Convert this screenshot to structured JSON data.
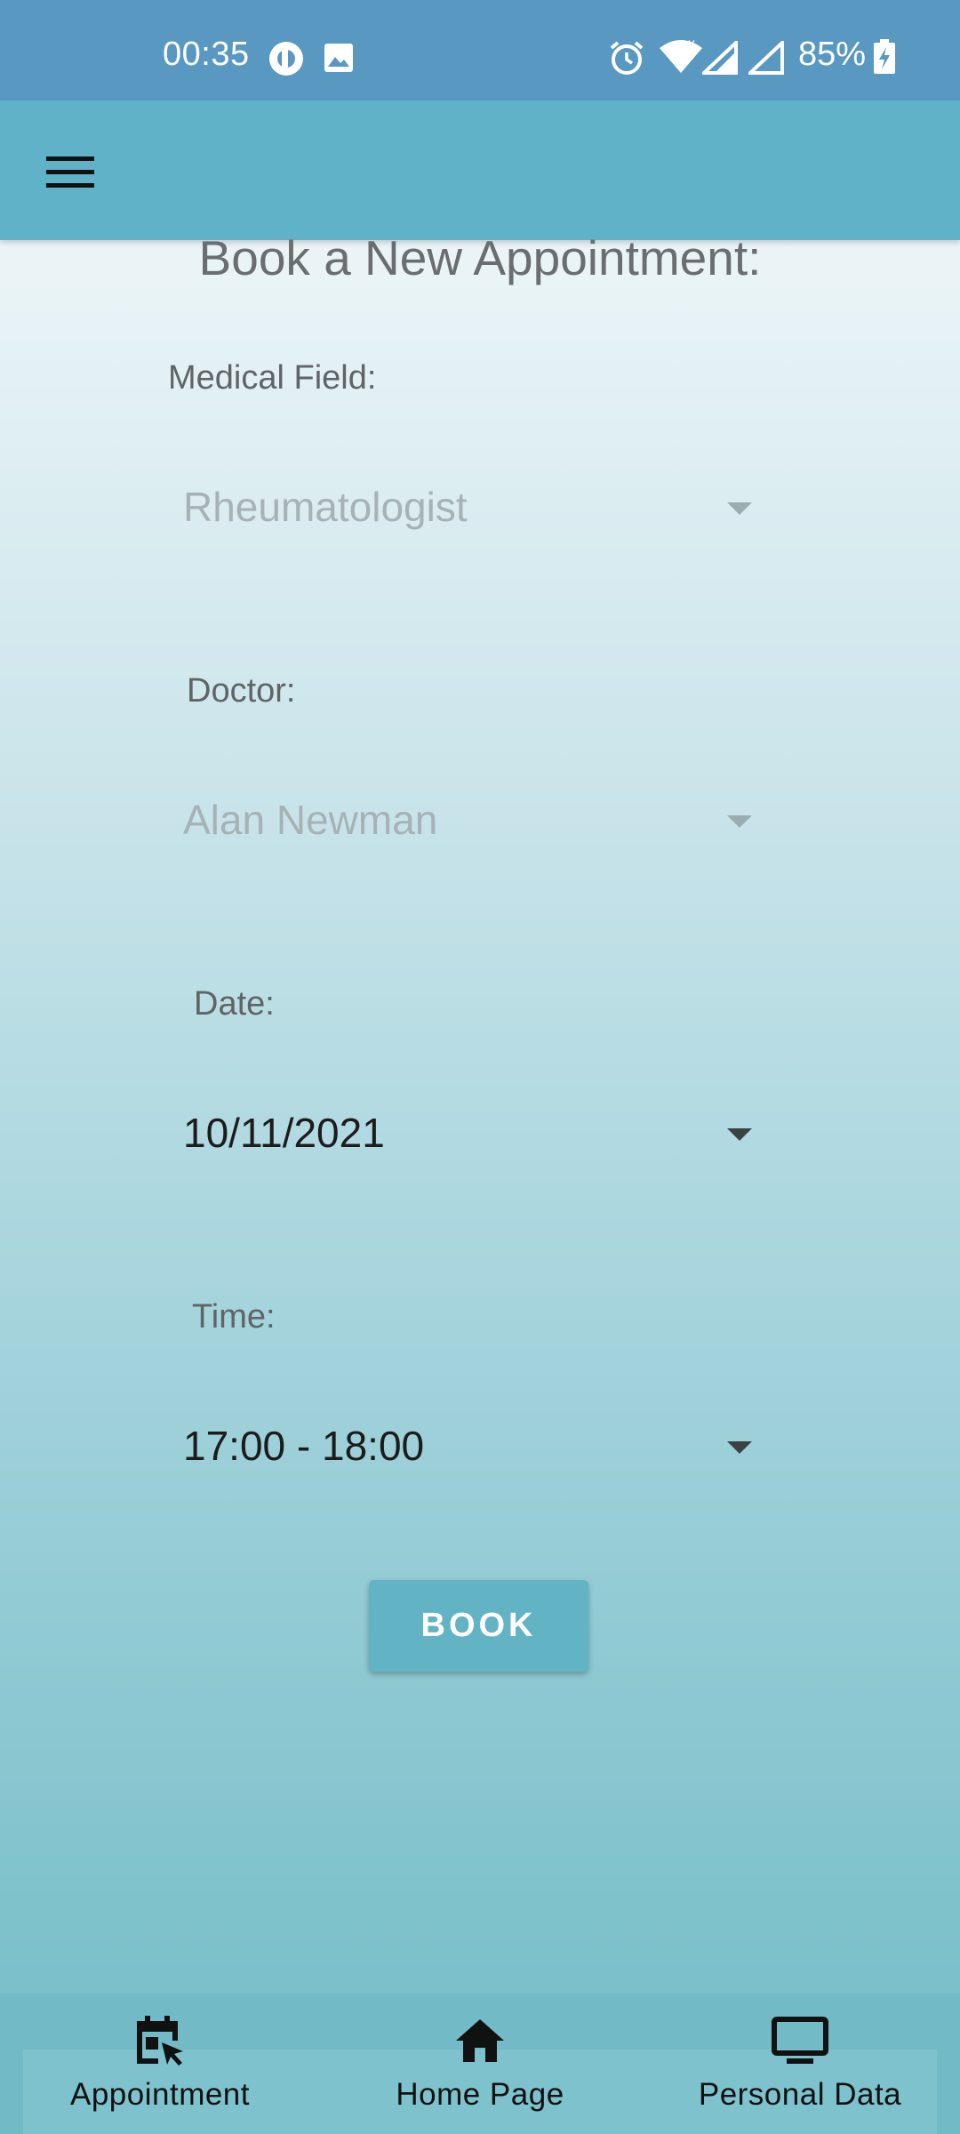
{
  "status_bar": {
    "time": "00:35",
    "battery": "85%",
    "icons": [
      "pocket-casts-icon",
      "image-icon",
      "alarm-icon",
      "wifi-icon",
      "signal-icon",
      "signal-icon",
      "battery-charging-icon"
    ]
  },
  "app_bar": {
    "menu_icon": "hamburger-menu-icon"
  },
  "page": {
    "title": "Book a New Appointment:"
  },
  "form": {
    "medical_field": {
      "label": "Medical Field:",
      "value": "Rheumatologist",
      "enabled": false
    },
    "doctor": {
      "label": "Doctor:",
      "value": "Alan Newman",
      "enabled": false
    },
    "date": {
      "label": "Date:",
      "value": "10/11/2021",
      "enabled": true
    },
    "time": {
      "label": "Time:",
      "value": "17:00 - 18:00",
      "enabled": true
    },
    "book_label": "BOOK"
  },
  "bottom_nav": {
    "items": [
      {
        "label": "Appointment",
        "icon": "calendar-cursor-icon"
      },
      {
        "label": "Home Page",
        "icon": "home-icon"
      },
      {
        "label": "Personal Data",
        "icon": "monitor-icon"
      }
    ]
  },
  "colors": {
    "status_bar": "#5898c1",
    "app_bar": "#5fb2c7",
    "button": "#62b3c3",
    "bottom_nav": "#73bac7"
  }
}
